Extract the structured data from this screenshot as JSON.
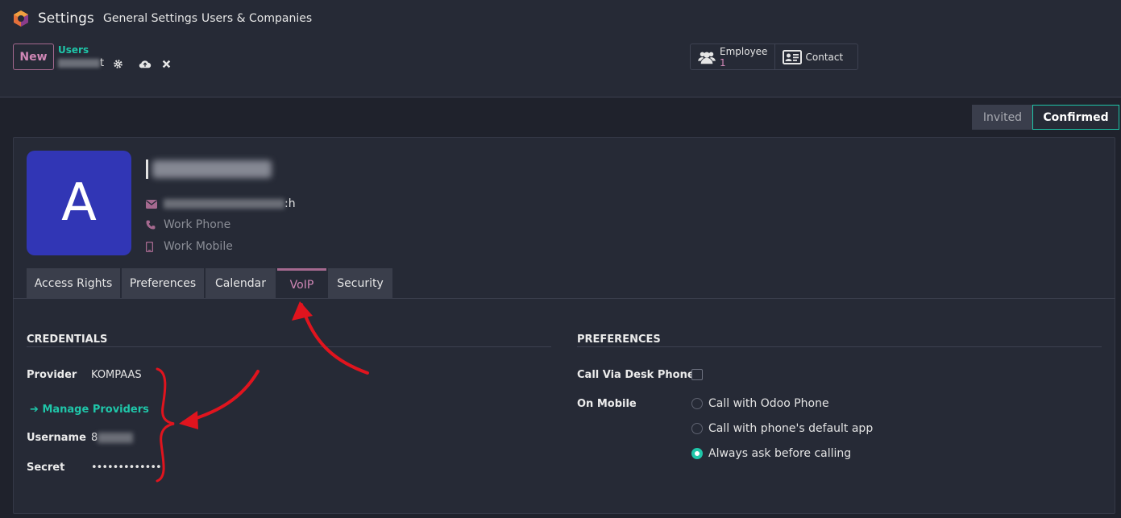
{
  "app": {
    "title": "Settings"
  },
  "topnav": {
    "general_settings": "General Settings",
    "users_companies": "Users & Companies"
  },
  "control_panel": {
    "new_label": "New",
    "breadcrumb_parent": "Users",
    "breadcrumb_record_suffix": "t"
  },
  "smart_buttons": {
    "employee_label": "Employee",
    "employee_count": "1",
    "contact_label": "Contact"
  },
  "status": {
    "invited": "Invited",
    "confirmed": "Confirmed",
    "current": "Confirmed"
  },
  "user": {
    "avatar_letter": "A",
    "email_suffix": ":h",
    "work_phone_placeholder": "Work Phone",
    "work_mobile_placeholder": "Work Mobile"
  },
  "tabs": [
    {
      "label": "Access Rights"
    },
    {
      "label": "Preferences"
    },
    {
      "label": "Calendar"
    },
    {
      "label": "VoIP",
      "active": true
    },
    {
      "label": "Security"
    }
  ],
  "credentials": {
    "title": "CREDENTIALS",
    "provider_label": "Provider",
    "provider_value": "KOMPAAS",
    "manage_providers": "Manage Providers",
    "username_label": "Username",
    "username_prefix": "8",
    "secret_label": "Secret",
    "secret_value": "•••••••••••••"
  },
  "preferences": {
    "title": "PREFERENCES",
    "desk_phone_label": "Call Via Desk Phone",
    "desk_phone_checked": false,
    "on_mobile_label": "On Mobile",
    "options": [
      {
        "label": "Call with Odoo Phone",
        "selected": false
      },
      {
        "label": "Call with phone's default app",
        "selected": false
      },
      {
        "label": "Always ask before calling",
        "selected": true
      }
    ]
  },
  "colors": {
    "accent_teal": "#1fc6a9",
    "accent_purple": "#a5698f",
    "avatar_bg": "#3136b5",
    "annotation_red": "#e0141e"
  }
}
